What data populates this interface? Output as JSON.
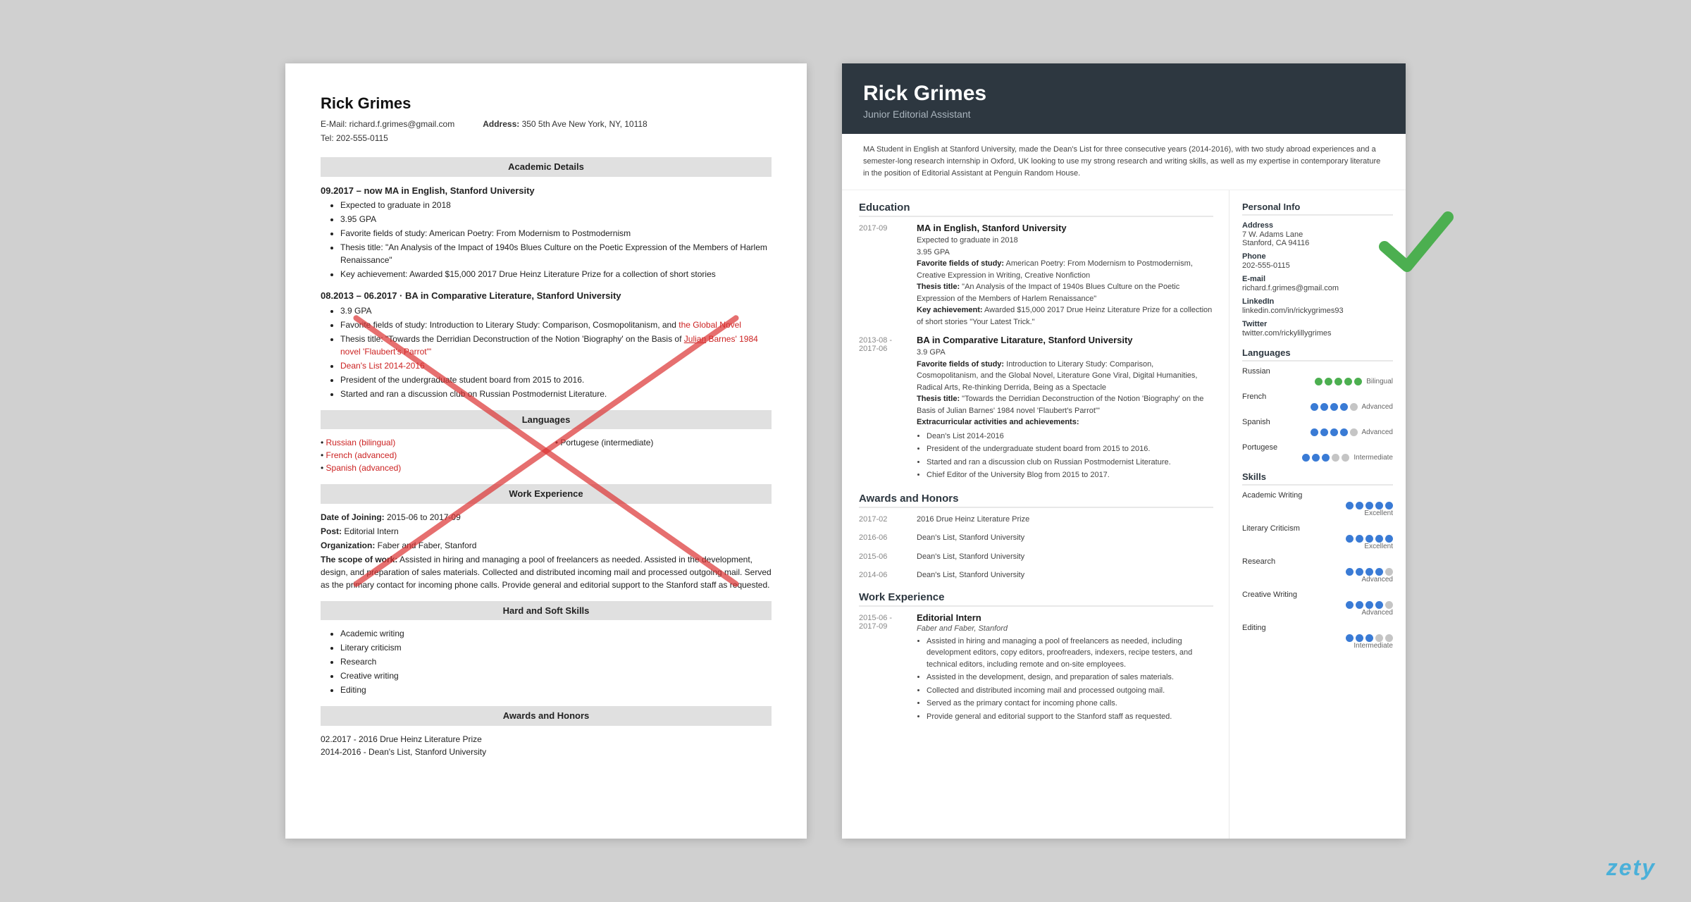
{
  "brand": "zety",
  "left": {
    "name": "Rick Grimes",
    "email": "E-Mail: richard.f.grimes@gmail.com",
    "tel": "Tel: 202-555-0115",
    "address_label": "Address:",
    "address": "350 5th Ave New York, NY, 10118",
    "sections": {
      "academic": "Academic Details",
      "languages": "Languages",
      "work": "Work Experience",
      "skills": "Hard and Soft Skills",
      "awards": "Awards and Honors"
    },
    "education": [
      {
        "date": "09.2017 – now",
        "degree": "MA in English, Stanford University",
        "bullets": [
          "Expected to graduate in 2018",
          "3.95 GPA",
          "Favorite fields of study: American Poetry: From Modernism to Postmodernism",
          "Thesis title: \"An Analysis of the Impact of 1940s Blues Culture on the Poetic Expression of the Members of Harlem Renaissance\"",
          "Key achievement: Awarded $15,000 2017 Drue Heinz Literature Prize for a collection of short stories"
        ]
      },
      {
        "date": "08.2013 – 06.2017",
        "degree": "BA in Comparative Literature, Stanford University",
        "bullets": [
          "3.9 GPA",
          "Favorite fields of study: Introduction to Literary Study: Comparison, Cosmopolitanism, and the Global Novel",
          "Thesis title: \"Towards the Derridian Deconstruction of the Notion 'Biography' on the Basis of Julian Barnes' 1984 novel 'Flaubert's Parrot'\"",
          "Dean's List 2014-2016",
          "President of the undergraduate student board from 2015 to 2016.",
          "Started and ran a discussion club on Russian Postmodernist Literature."
        ]
      }
    ],
    "languages": {
      "left": [
        "Russian (bilingual)",
        "French (advanced)",
        "Spanish (advanced)"
      ],
      "right": [
        "Portugese (intermediate)"
      ]
    },
    "work": {
      "date": "Date of Joining: 2015-06 to 2017-09",
      "post": "Post: Editorial Intern",
      "org": "Organization: Faber and Faber, Stanford",
      "scope": "The scope of work: Assisted in hiring and managing a pool of freelancers as needed. Assisted in the development, design, and preparation of sales materials. Collected and distributed incoming mail and processed outgoing mail. Served as the primary contact for incoming phone calls. Provide general and editorial support to the Stanford staff as requested."
    },
    "skills": [
      "Academic writing",
      "Literary criticism",
      "Research",
      "Creative writing",
      "Editing"
    ],
    "awards": [
      "02.2017 - 2016 Drue Heinz Literature Prize",
      "2014-2016 - Dean's List, Stanford University"
    ]
  },
  "right": {
    "name": "Rick Grimes",
    "title": "Junior Editorial Assistant",
    "summary": "MA Student in English at Stanford University, made the Dean's List for three consecutive years (2014-2016), with two study abroad experiences and a semester-long research internship in Oxford, UK looking to use my strong research and writing skills, as well as my expertise in contemporary literature in the position of Editorial Assistant at Penguin Random House.",
    "education_section": "Education",
    "education": [
      {
        "date": "2017-09",
        "degree": "MA in English, Stanford University",
        "details": "Expected to graduate in 2018\n3.95 GPA\nFavorite fields of study: American Poetry: From Modernism to Postmodernism, Creative Expression in Writing, Creative Nonfiction\nThesis title: \"An Analysis of the Impact of 1940s Blues Culture on the Poetic Expression of the Members of Harlem Renaissance\"\nKey achievement: Awarded $15,000 2017 Drue Heinz Literature Prize for a collection of short stories \"Your Latest Trick.\""
      },
      {
        "date": "2013-08 - 2017-06",
        "degree": "BA in Comparative Litarature, Stanford University",
        "details_gpa": "3.9 GPA",
        "details_fav": "Favorite fields of study: Introduction to Literary Study: Comparison, Cosmopolitanism, and the Global Novel, Literature Gone Viral, Digital Humanities, Radical Arts, Re-thinking Derrida, Being as a Spectacle",
        "details_thesis": "Thesis title: \"Towards the Derridian Deconstruction of the Notion 'Biography' on the Basis of Julian Barnes' 1984 novel 'Flaubert's Parrot'\"",
        "extra": "Extracurricular activities and achievements:",
        "extra_bullets": [
          "Dean's List 2014-2016",
          "President of the undergraduate student board from 2015 to 2016.",
          "Started and ran a discussion club on Russian Postmodernist Literature.",
          "Chief Editor of the University Blog from 2015 to 2017."
        ]
      }
    ],
    "awards_section": "Awards and Honors",
    "awards": [
      {
        "date": "2017-02",
        "text": "2016 Drue Heinz Literature Prize"
      },
      {
        "date": "2016-06",
        "text": "Dean's List, Stanford University"
      },
      {
        "date": "2015-06",
        "text": "Dean's List, Stanford University"
      },
      {
        "date": "2014-06",
        "text": "Dean's List, Stanford University"
      }
    ],
    "work_section": "Work Experience",
    "work": [
      {
        "date": "2015-06 - 2017-09",
        "title": "Editorial Intern",
        "org": "Faber and Faber, Stanford",
        "bullets": [
          "Assisted in hiring and managing a pool of freelancers as needed, including development editors, copy editors, proofreaders, indexers, recipe testers, and technical editors, including remote and on-site employees.",
          "Assisted in the development, design, and preparation of sales materials.",
          "Collected and distributed incoming mail and processed outgoing mail.",
          "Served as the primary contact for incoming phone calls.",
          "Provide general and editorial support to the Stanford staff as requested."
        ]
      }
    ],
    "sidebar": {
      "personal_info": "Personal Info",
      "address_label": "Address",
      "address": "7 W. Adams Lane\nStanford, CA 94116",
      "phone_label": "Phone",
      "phone": "202-555-0115",
      "email_label": "E-mail",
      "email": "richard.f.grimes@gmail.com",
      "linkedin_label": "LinkedIn",
      "linkedin": "linkedin.com/in/rickygrimes93",
      "twitter_label": "Twitter",
      "twitter": "twitter.com/rickylillygrimes",
      "languages_section": "Languages",
      "languages": [
        {
          "name": "Russian",
          "level": "Bilingual",
          "filled": 5,
          "total": 5,
          "green": true
        },
        {
          "name": "French",
          "level": "Advanced",
          "filled": 4,
          "total": 5,
          "green": false
        },
        {
          "name": "Spanish",
          "level": "Advanced",
          "filled": 4,
          "total": 5,
          "green": false
        },
        {
          "name": "Portugese",
          "level": "Intermediate",
          "filled": 3,
          "total": 5,
          "green": false
        }
      ],
      "skills_section": "Skills",
      "skills": [
        {
          "name": "Academic Writing",
          "level": "Excellent",
          "filled": 5,
          "total": 5
        },
        {
          "name": "Literary Criticism",
          "level": "Excellent",
          "filled": 5,
          "total": 5
        },
        {
          "name": "Research",
          "level": "Advanced",
          "filled": 4,
          "total": 5
        },
        {
          "name": "Creative Writing",
          "level": "Advanced",
          "filled": 4,
          "total": 5
        },
        {
          "name": "Editing",
          "level": "Intermediate",
          "filled": 3,
          "total": 5
        }
      ]
    }
  }
}
